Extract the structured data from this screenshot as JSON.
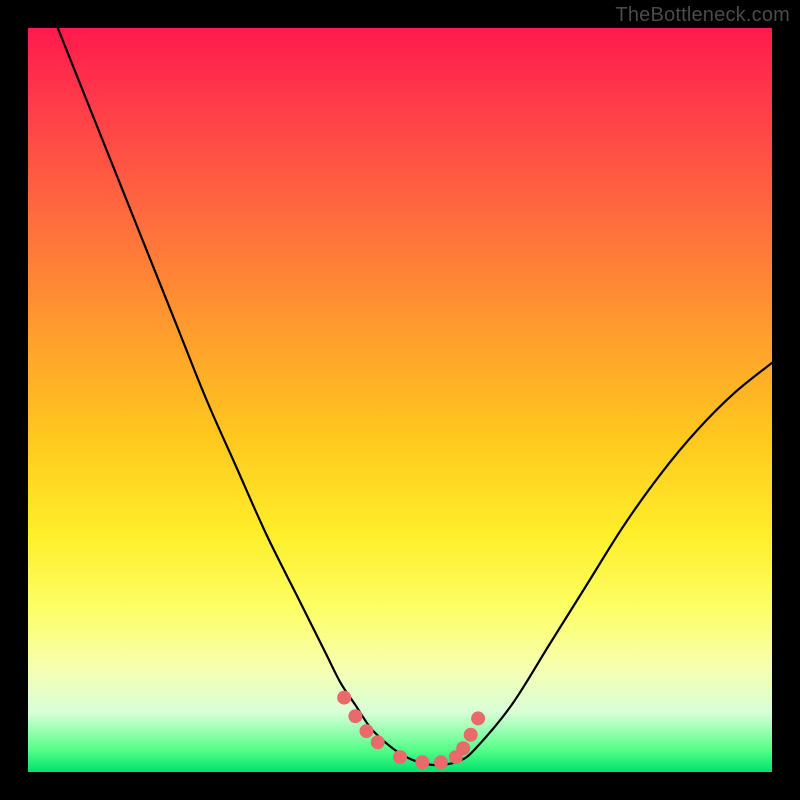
{
  "attribution": "TheBottleneck.com",
  "colors": {
    "frame": "#000000",
    "curve": "#000000",
    "marker_fill": "#e86a6a",
    "marker_stroke": "#d85a5a",
    "gradient_top": "#ff1a4d",
    "gradient_bottom": "#00e26e"
  },
  "chart_data": {
    "type": "line",
    "title": "",
    "xlabel": "",
    "ylabel": "",
    "xlim": [
      0,
      100
    ],
    "ylim": [
      0,
      100
    ],
    "series": [
      {
        "name": "bottleneck-curve",
        "x": [
          4,
          8,
          12,
          16,
          20,
          24,
          28,
          32,
          36,
          38,
          40,
          42,
          44,
          46,
          48,
          50,
          52,
          54,
          56,
          58,
          60,
          65,
          70,
          75,
          80,
          85,
          90,
          95,
          100
        ],
        "y": [
          100,
          90,
          80,
          70,
          60,
          50,
          41,
          32,
          24,
          20,
          16,
          12,
          9,
          6,
          4,
          2.5,
          1.5,
          1,
          1,
          1.5,
          3,
          9,
          17,
          25,
          33,
          40,
          46,
          51,
          55
        ]
      }
    ],
    "markers": {
      "name": "highlight-points",
      "x": [
        42.5,
        44,
        45.5,
        47,
        50,
        53,
        55.5,
        57.5,
        58.5,
        59.5,
        60.5
      ],
      "y": [
        10,
        7.5,
        5.5,
        4,
        2,
        1.3,
        1.3,
        2,
        3.2,
        5,
        7.2
      ]
    }
  }
}
